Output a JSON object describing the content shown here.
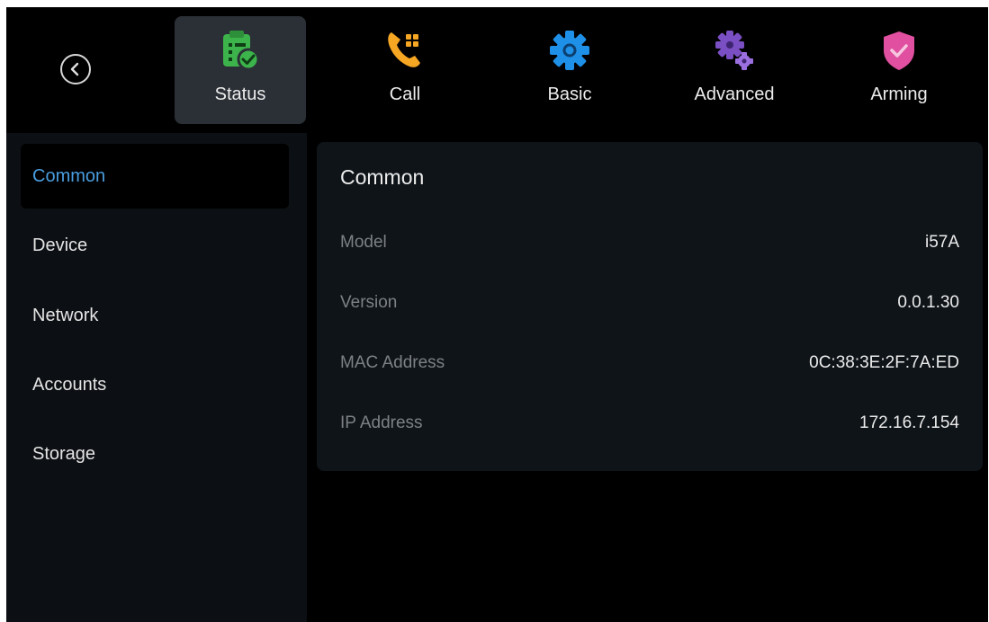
{
  "nav": {
    "tabs": [
      {
        "label": "Status",
        "icon": "status-clipboard-check-icon",
        "color": "#3cb44b",
        "active": true
      },
      {
        "label": "Call",
        "icon": "phone-dialpad-icon",
        "color": "#f5a623",
        "active": false
      },
      {
        "label": "Basic",
        "icon": "gear-icon",
        "color": "#1e90e8",
        "active": false
      },
      {
        "label": "Advanced",
        "icon": "gears-icon",
        "color": "#7b4fc4",
        "active": false
      },
      {
        "label": "Arming",
        "icon": "shield-check-icon",
        "color": "#e04fa0",
        "active": false
      }
    ]
  },
  "sidebar": {
    "items": [
      {
        "label": "Common",
        "active": true
      },
      {
        "label": "Device",
        "active": false
      },
      {
        "label": "Network",
        "active": false
      },
      {
        "label": "Accounts",
        "active": false
      },
      {
        "label": "Storage",
        "active": false
      }
    ]
  },
  "main": {
    "title": "Common",
    "rows": [
      {
        "key": "Model",
        "value": "i57A"
      },
      {
        "key": "Version",
        "value": "0.0.1.30"
      },
      {
        "key": "MAC Address",
        "value": "0C:38:3E:2F:7A:ED"
      },
      {
        "key": "IP Address",
        "value": "172.16.7.154"
      }
    ]
  },
  "colors": {
    "accent": "#4a9ee0",
    "background": "#000000",
    "sidebar": "#0c0f13",
    "panel": "#0f1419"
  }
}
